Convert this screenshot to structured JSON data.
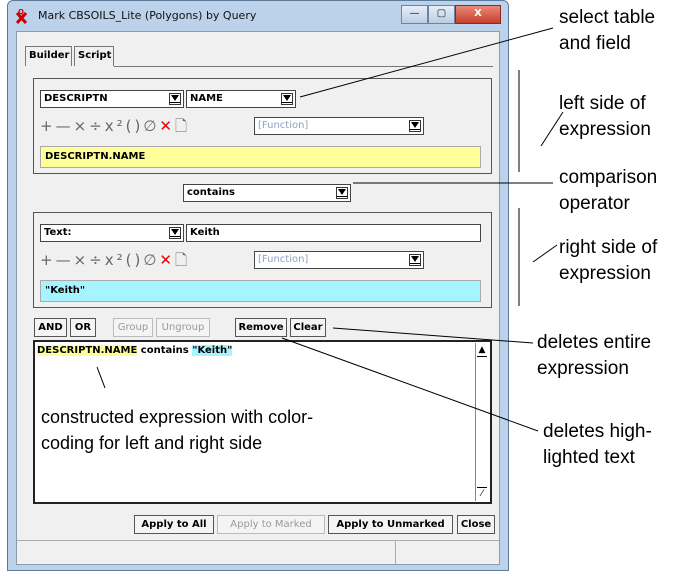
{
  "window": {
    "title": "Mark CBSOILS_Lite (Polygons) by Query",
    "controls": {
      "minimize": "—",
      "maximize": "▢",
      "close": "X"
    }
  },
  "tabs": [
    {
      "label": "Builder"
    },
    {
      "label": "Script"
    }
  ],
  "left_side": {
    "table_select": "DESCRIPTN",
    "field_select": "NAME",
    "function_select": "[Function]",
    "expression": "DESCRIPTN.NAME"
  },
  "comparison": {
    "operator": "contains"
  },
  "right_side": {
    "type_select": "Text:",
    "value_input": "Keith",
    "function_select": "[Function]",
    "expression": "\"Keith\""
  },
  "buttons": {
    "and": "AND",
    "or": "OR",
    "group": "Group",
    "ungroup": "Ungroup",
    "remove": "Remove",
    "clear": "Clear",
    "apply_all": "Apply to All",
    "apply_marked": "Apply to Marked",
    "apply_unmarked": "Apply to Unmarked",
    "close": "Close"
  },
  "expression_text": {
    "left": "DESCRIPTN.NAME",
    "op": " contains ",
    "right": "\"Keith\""
  },
  "annotations": {
    "select_table": [
      "select table",
      "and field"
    ],
    "left_side": [
      "left side of",
      "expression"
    ],
    "comparison": [
      "comparison",
      "operator"
    ],
    "right_side": [
      "right side of",
      "expression"
    ],
    "deletes_entire": [
      "deletes entire",
      "expression"
    ],
    "deletes_high": [
      "deletes high-",
      "lighted text"
    ],
    "constructed": [
      "constructed expression with color-",
      "coding for left and right side"
    ]
  },
  "colors": {
    "left_highlight": "#ffff99",
    "right_highlight": "#a6f4ff",
    "delete_icon": "#e00000",
    "disabled_text": "#8ea2c8"
  }
}
